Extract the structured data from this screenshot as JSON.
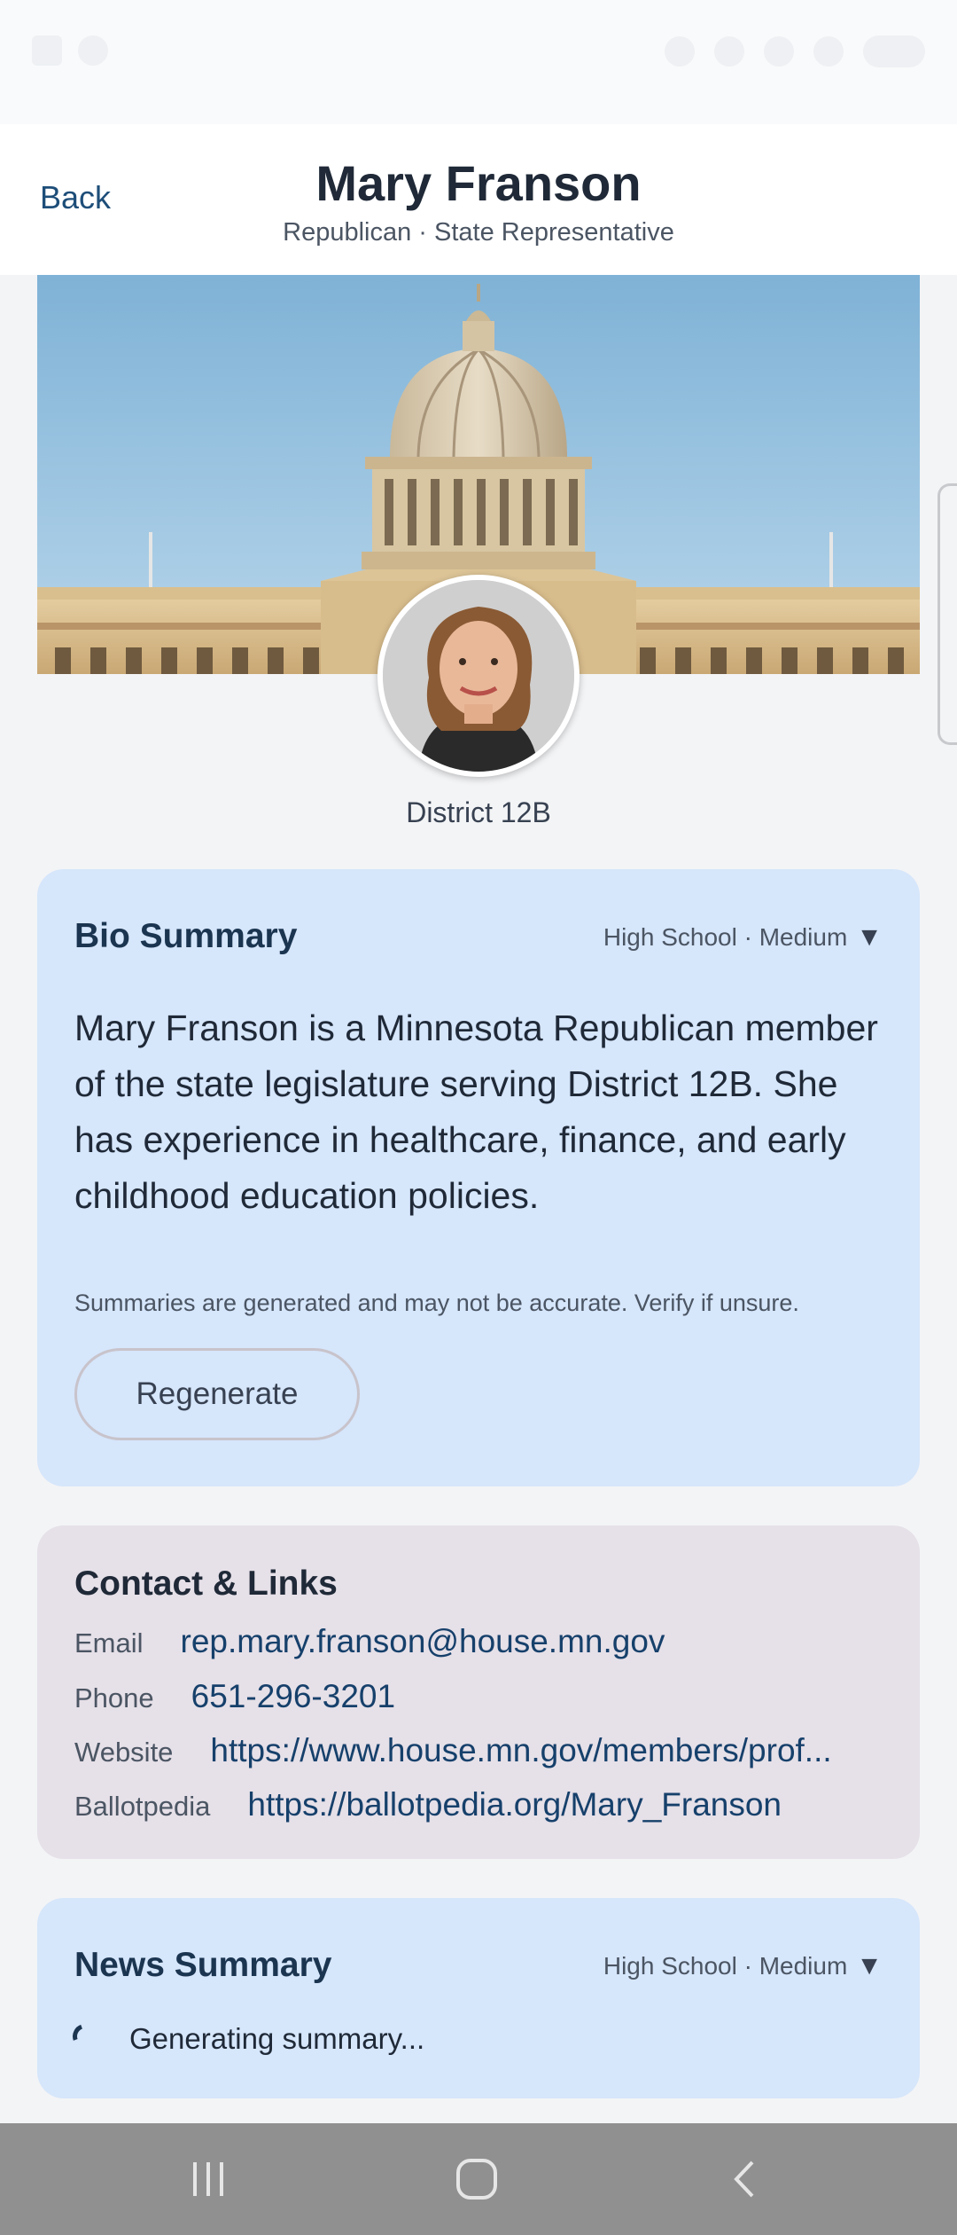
{
  "header": {
    "back_label": "Back",
    "title": "Mary Franson",
    "subtitle": "Republican · State Representative"
  },
  "profile": {
    "district": "District 12B"
  },
  "bio": {
    "title": "Bio Summary",
    "level": "High School · Medium",
    "text": "Mary Franson is a Minnesota Republican member of the state legislature serving District 12B. She has experience in healthcare, finance, and early childhood education policies.",
    "disclaimer": "Summaries are generated and may not be accurate. Verify if unsure.",
    "regenerate_label": "Regenerate"
  },
  "contact": {
    "title": "Contact & Links",
    "email_label": "Email",
    "email_value": "rep.mary.franson@house.mn.gov",
    "phone_label": "Phone",
    "phone_value": "651-296-3201",
    "website_label": "Website",
    "website_value": "https://www.house.mn.gov/members/prof...",
    "ballotpedia_label": "Ballotpedia",
    "ballotpedia_value": "https://ballotpedia.org/Mary_Franson"
  },
  "news": {
    "title": "News Summary",
    "level": "High School · Medium",
    "status": "Generating summary..."
  },
  "colors": {
    "accent": "#1e4e79",
    "card_blue": "#d6e6fb",
    "card_mauve": "#e6e0e8",
    "nav_bar": "#909090"
  },
  "icons": {
    "caret": "caret-down-icon",
    "spinner": "loading-spinner-icon",
    "nav_recents": "recents-icon",
    "nav_home": "home-icon",
    "nav_back": "back-icon"
  }
}
